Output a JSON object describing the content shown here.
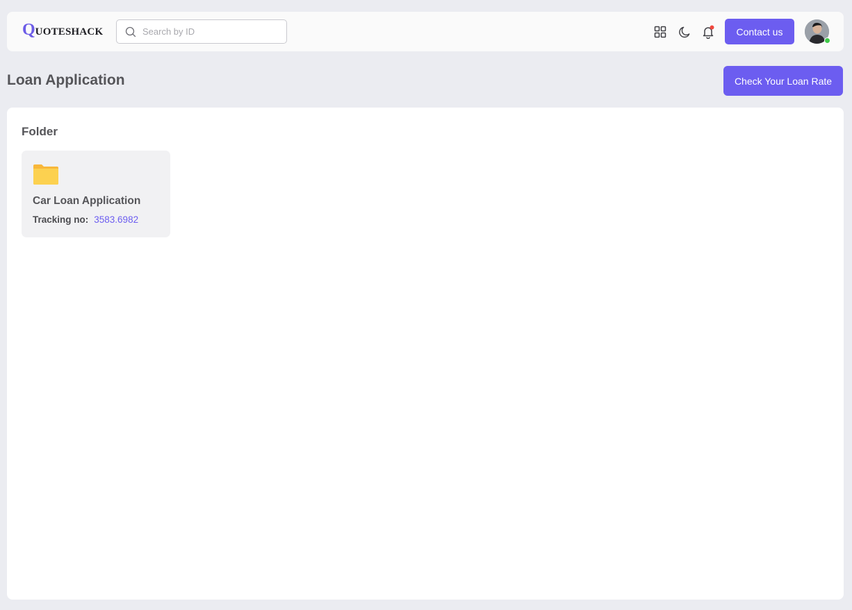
{
  "header": {
    "logo_initial": "Q",
    "logo_rest": "UOTESHACK",
    "search_placeholder": "Search by ID",
    "search_value": "",
    "contact_label": "Contact us",
    "notification_dot_color": "#f0483e",
    "online_status_color": "#40c94a"
  },
  "page": {
    "title": "Loan Application",
    "check_rate_label": "Check Your Loan Rate"
  },
  "folder_section": {
    "title": "Folder",
    "folders": [
      {
        "name": "Car Loan Application",
        "tracking_label": "Tracking no:",
        "tracking_value": "3583.6982"
      }
    ]
  },
  "colors": {
    "accent": "#6c5df0",
    "background": "#ebecf1",
    "folder_yellow": "#fcd150"
  }
}
